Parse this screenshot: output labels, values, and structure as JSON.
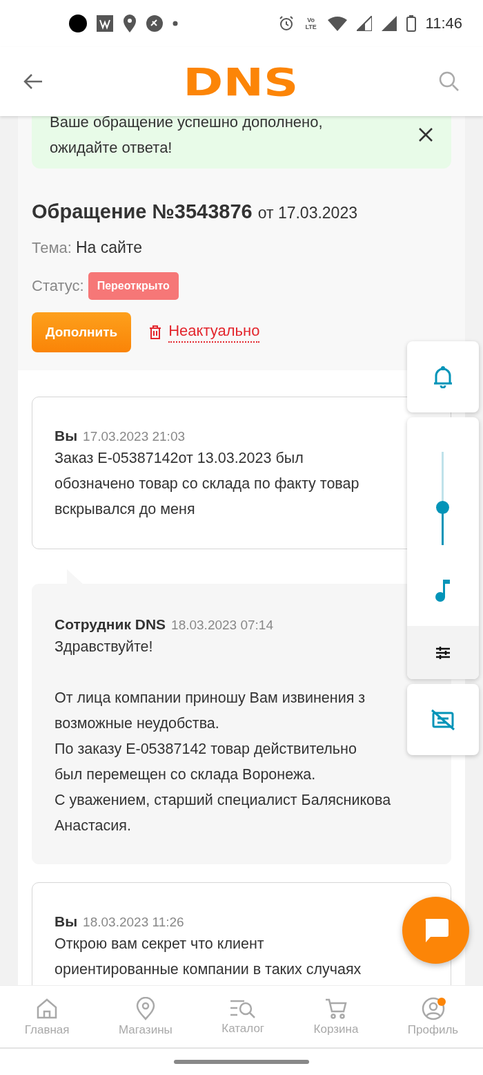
{
  "status_bar": {
    "network_label": "Vo LTE",
    "time": "11:46"
  },
  "header": {
    "logo": "DNS"
  },
  "notice": {
    "text": "Ваше обращение успешно дополнено,\nожидайте ответа!"
  },
  "ticket": {
    "title": "Обращение №3543876",
    "date": "от 17.03.2023",
    "topic_label": "Тема:",
    "topic": "На сайте",
    "status_label": "Статус:",
    "status": "Переоткрыто",
    "add_button": "Дополнить",
    "irrelevant_link": "Неактуально"
  },
  "messages": [
    {
      "kind": "client",
      "author": "Вы",
      "time": "17.03.2023 21:03",
      "text": "Заказ Е-05387142от 13.03.2023 был\nобозначено товар со склада по факту товар\nвскрывался до меня"
    },
    {
      "kind": "staff",
      "author": "Сотрудник DNS",
      "time": "18.03.2023 07:14",
      "text": "Здравствуйте!\n\nОт лица компании приношу Вам извинения з\nвозможные неудобства.\nПо заказу Е-05387142 товар действительно\nбыл перемещен со склада Воронежа.\nС уважением, старший специалист Балясникова\nАнастасия."
    },
    {
      "kind": "client",
      "author": "Вы",
      "time": "18.03.2023 11:26",
      "text": "Открою вам секрет что клиент\nориентированные компании в таких случаях"
    }
  ],
  "volume_panel": {
    "level": 0.4
  },
  "nav": [
    {
      "label": "Главная",
      "selected": false
    },
    {
      "label": "Магазины",
      "selected": false
    },
    {
      "label": "Каталог",
      "selected": false
    },
    {
      "label": "Корзина",
      "selected": false
    },
    {
      "label": "Профиль",
      "selected": false,
      "badge": true
    }
  ]
}
